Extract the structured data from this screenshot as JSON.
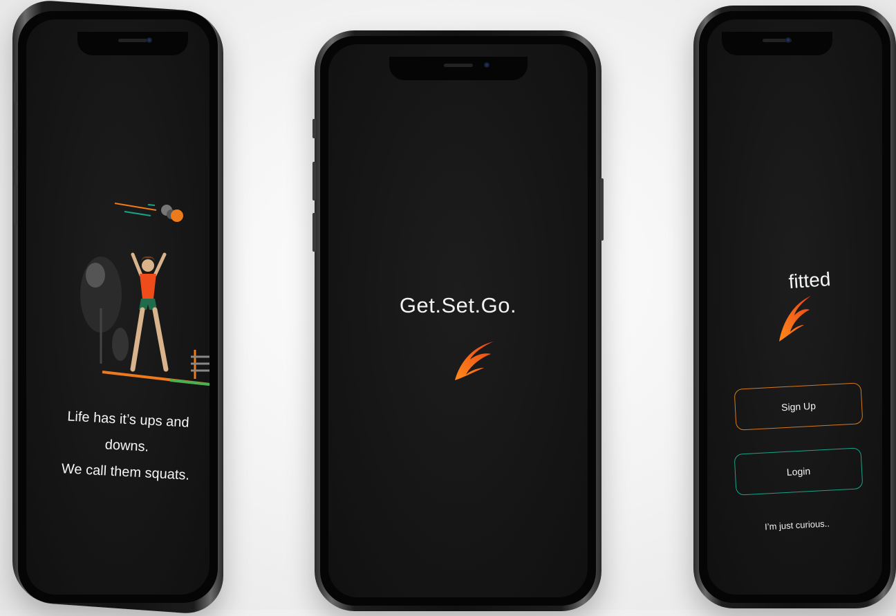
{
  "screens": {
    "left": {
      "quote_line1": "Life has it’s ups and downs.",
      "quote_line2": "We call them squats."
    },
    "middle": {
      "tagline": "Get.Set.Go."
    },
    "right": {
      "brand": "fitted",
      "signup_label": "Sign Up",
      "login_label": "Login",
      "curious_label": "I’m just curious.."
    }
  },
  "colors": {
    "accent_orange": "#ee7a1c",
    "accent_teal": "#17a589",
    "screen_bg": "#141414"
  },
  "icons": {
    "logo": "fitted-flame-logo-icon",
    "illustration": "squat-exercise-illustration"
  }
}
